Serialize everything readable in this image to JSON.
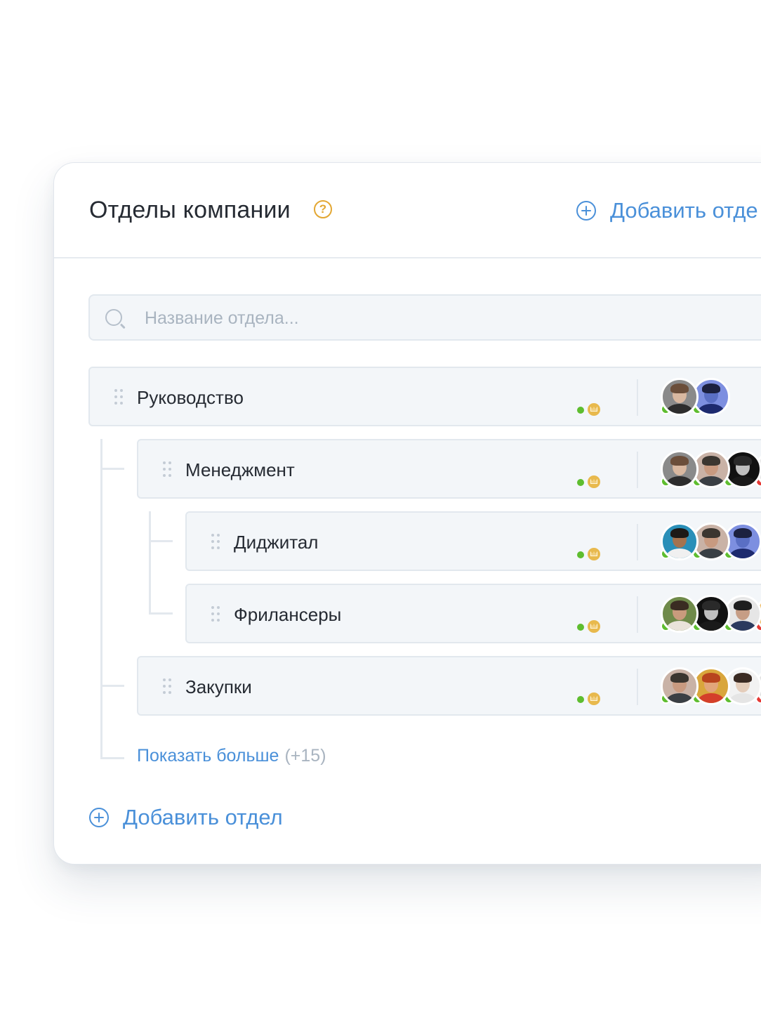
{
  "panel": {
    "title": "Отделы компании",
    "help_icon": "question-circle-icon",
    "header_add_label": "Добавить отде",
    "footer_add_label": "Добавить отдел"
  },
  "search": {
    "placeholder": "Название отдела..."
  },
  "departments": [
    {
      "name": "Руководство",
      "level": 0,
      "members": [
        {
          "skin": "#d9b8a0",
          "hair": "#6b4e3a",
          "shirt": "#2d2d2d",
          "bg": "#8a8a8a",
          "status": "online"
        },
        {
          "skin": "#5a6fc4",
          "hair": "#1c2140",
          "shirt": "#1d2a6e",
          "bg": "#7d8fe0",
          "status": "online"
        }
      ]
    },
    {
      "name": "Менеджмент",
      "level": 1,
      "members": [
        {
          "skin": "#d9b8a0",
          "hair": "#6b4e3a",
          "shirt": "#2d2d2d",
          "bg": "#8a8a8a",
          "status": "online"
        },
        {
          "skin": "#c89a80",
          "hair": "#3b3630",
          "shirt": "#3a3f44",
          "bg": "#c9b2a6",
          "status": "online"
        },
        {
          "skin": "#bfbfbf",
          "hair": "#2a2a2a",
          "shirt": "#1a1a1a",
          "bg": "#111111",
          "status": "online"
        },
        {
          "skin": "#d8d8d8",
          "hair": "#9a9a9a",
          "shirt": "#c9c9c9",
          "bg": "#e8e8e8",
          "status": "busy"
        }
      ]
    },
    {
      "name": "Диджитал",
      "level": 2,
      "members": [
        {
          "skin": "#a5734f",
          "hair": "#1d1a17",
          "shirt": "#f0f0f0",
          "bg": "#2a8fb8",
          "status": "online"
        },
        {
          "skin": "#c89a80",
          "hair": "#3b3630",
          "shirt": "#3a3f44",
          "bg": "#c9b2a6",
          "status": "online"
        },
        {
          "skin": "#5a6fc4",
          "hair": "#1c2140",
          "shirt": "#1d2a6e",
          "bg": "#7d8fe0",
          "status": "online"
        }
      ]
    },
    {
      "name": "Фрилансеры",
      "level": 2,
      "members": [
        {
          "skin": "#c99b7d",
          "hair": "#3a2c22",
          "shirt": "#e9e3da",
          "bg": "#6f8a4a",
          "status": "online"
        },
        {
          "skin": "#bfbfbf",
          "hair": "#2a2a2a",
          "shirt": "#1a1a1a",
          "bg": "#111111",
          "status": "online"
        },
        {
          "skin": "#c69d85",
          "hair": "#1e1e1e",
          "shirt": "#2b3a5e",
          "bg": "#e6e6e6",
          "status": "online"
        },
        {
          "skin": "#d9a060",
          "hair": "#c47a1e",
          "shirt": "#d98a2c",
          "bg": "#f0c070",
          "status": "busy"
        }
      ]
    },
    {
      "name": "Закупки",
      "level": 1,
      "members": [
        {
          "skin": "#c89a80",
          "hair": "#3b3630",
          "shirt": "#3a3f44",
          "bg": "#c9b2a6",
          "status": "online"
        },
        {
          "skin": "#e2a57a",
          "hair": "#b8441e",
          "shirt": "#d43f2a",
          "bg": "#d9a63c",
          "status": "online"
        },
        {
          "skin": "#e4cdbb",
          "hair": "#3a2a22",
          "shirt": "#e5e5e5",
          "bg": "#f2f2f2",
          "status": "online"
        },
        {
          "skin": "#e6b8a0",
          "hair": "#a03a2a",
          "shirt": "#c44",
          "bg": "#e0e0e0",
          "status": "busy"
        }
      ]
    }
  ],
  "show_more": {
    "label": "Показать больше",
    "count": "(+15)"
  },
  "colors": {
    "accent": "#4a90d9",
    "online": "#5ebd2f",
    "busy": "#e53935",
    "crown": "#e8b94d",
    "help": "#e3a733"
  }
}
